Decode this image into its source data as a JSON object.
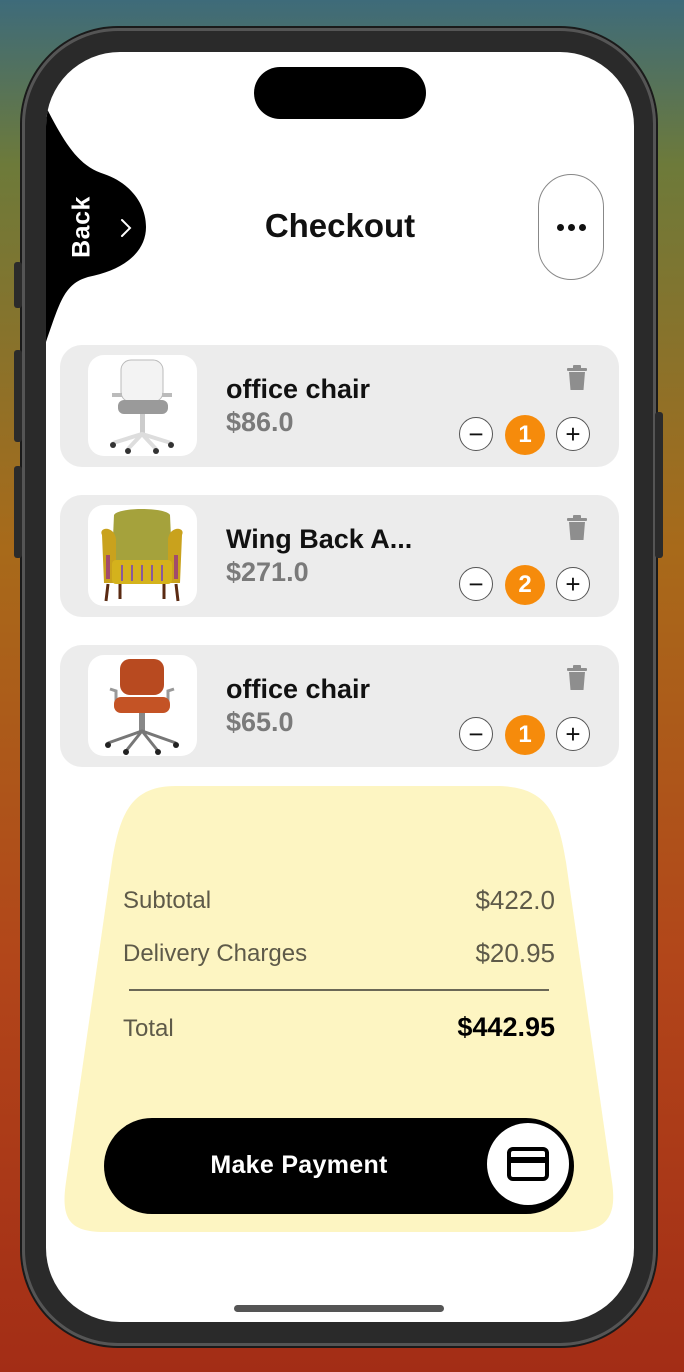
{
  "header": {
    "back_label": "Back",
    "title": "Checkout",
    "more_icon": "more-horizontal-icon"
  },
  "cart": {
    "items": [
      {
        "name": "office chair",
        "price": "$86.0",
        "quantity": "1",
        "image": "white-office-chair"
      },
      {
        "name": "Wing Back A...",
        "price": "$271.0",
        "quantity": "2",
        "image": "yellow-wing-back-armchair"
      },
      {
        "name": "office chair",
        "price": "$65.0",
        "quantity": "1",
        "image": "orange-office-chair"
      }
    ],
    "minus_symbol": "−",
    "plus_symbol": "+"
  },
  "summary": {
    "subtotal_label": "Subtotal",
    "subtotal_value": "$422.0",
    "delivery_label": "Delivery Charges",
    "delivery_value": "$20.95",
    "total_label": "Total",
    "total_value": "$442.95"
  },
  "payment": {
    "button_label": "Make Payment",
    "icon": "credit-card-icon"
  },
  "colors": {
    "accent_orange": "#f68b0b",
    "summary_bg": "#fdf5c2",
    "card_bg": "#ececec",
    "price_gray": "#7a7a7a"
  }
}
